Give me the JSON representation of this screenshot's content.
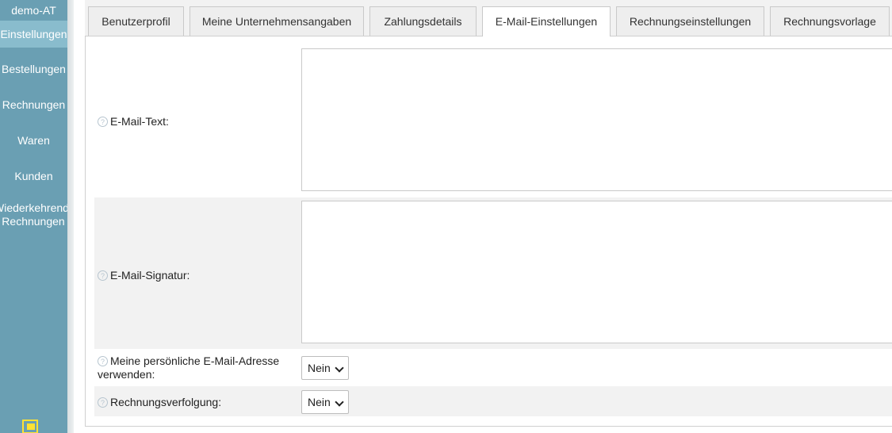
{
  "sidebar": {
    "brand": "demo-AT",
    "items": [
      {
        "label": "Einstellungen"
      },
      {
        "label": "Bestellungen"
      },
      {
        "label": "Rechnungen"
      },
      {
        "label": "Waren"
      },
      {
        "label": "Kunden"
      },
      {
        "label": "Wiederkehrende Rechnungen"
      }
    ]
  },
  "tabs": [
    {
      "label": "Benutzerprofil"
    },
    {
      "label": "Meine Unternehmensangaben"
    },
    {
      "label": "Zahlungsdetails"
    },
    {
      "label": "E-Mail-Einstellungen"
    },
    {
      "label": "Rechnungseinstellungen"
    },
    {
      "label": "Rechnungsvorlage"
    }
  ],
  "active_tab": "E-Mail-Einstellungen",
  "form": {
    "email_text_label": "E-Mail-Text:",
    "email_text_value": "",
    "signature_label": "E-Mail-Signatur:",
    "signature_value": "",
    "personal_email_label": "Meine persönliche E-Mail-Adresse verwenden:",
    "personal_email_value": "Nein",
    "tracking_label": "Rechnungsverfolgung:",
    "tracking_value": "Nein"
  },
  "icons": {
    "help": "help-icon",
    "logout": "logout-icon"
  },
  "colors": {
    "sidebar_bg": "#6a9fb3",
    "sidebar_active": "#89bccd",
    "logout_icon": "#ffe233"
  }
}
